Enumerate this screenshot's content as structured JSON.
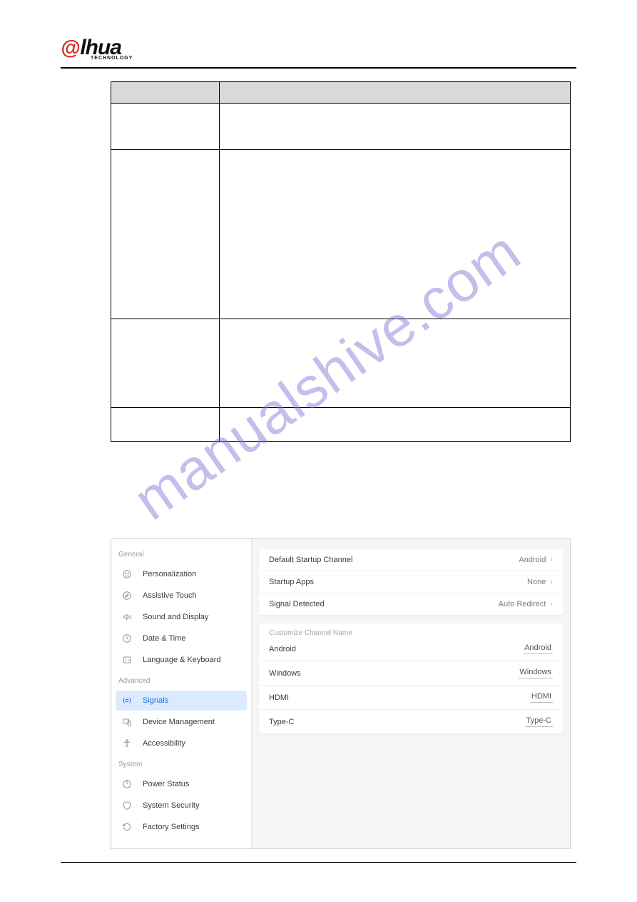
{
  "watermark": "manualshive.com",
  "logo": {
    "at": "@",
    "brand": "lhua",
    "tech": "TECHNOLOGY"
  },
  "sidebar": {
    "sections": [
      {
        "label": "General",
        "items": [
          {
            "key": "personalization",
            "label": "Personalization",
            "icon": "smiley-icon"
          },
          {
            "key": "assistive-touch",
            "label": "Assistive Touch",
            "icon": "compass-icon"
          },
          {
            "key": "sound-display",
            "label": "Sound and Display",
            "icon": "sound-icon"
          },
          {
            "key": "date-time",
            "label": "Date & Time",
            "icon": "clock-icon"
          },
          {
            "key": "lang-keyboard",
            "label": "Language & Keyboard",
            "icon": "language-icon"
          }
        ]
      },
      {
        "label": "Advanced",
        "items": [
          {
            "key": "signals",
            "label": "Signals",
            "icon": "signal-icon",
            "active": true
          },
          {
            "key": "device-mgmt",
            "label": "Device Management",
            "icon": "device-icon"
          },
          {
            "key": "accessibility",
            "label": "Accessibility",
            "icon": "accessibility-icon"
          }
        ]
      },
      {
        "label": "System",
        "items": [
          {
            "key": "power-status",
            "label": "Power Status",
            "icon": "power-icon"
          },
          {
            "key": "system-security",
            "label": "System Security",
            "icon": "shield-icon"
          },
          {
            "key": "factory",
            "label": "Factory Settings",
            "icon": "reset-icon"
          }
        ]
      }
    ]
  },
  "settings": {
    "default_startup_channel": {
      "label": "Default Startup Channel",
      "value": "Android"
    },
    "startup_apps": {
      "label": "Startup Apps",
      "value": "None"
    },
    "signal_detected": {
      "label": "Signal Detected",
      "value": "Auto Redirect"
    }
  },
  "channel_group_caption": "Customize Channel Name",
  "channels": [
    {
      "label": "Android",
      "value": "Android"
    },
    {
      "label": "Windows",
      "value": "Windows"
    },
    {
      "label": "HDMI",
      "value": "HDMI"
    },
    {
      "label": "Type-C",
      "value": "Type-C"
    }
  ]
}
